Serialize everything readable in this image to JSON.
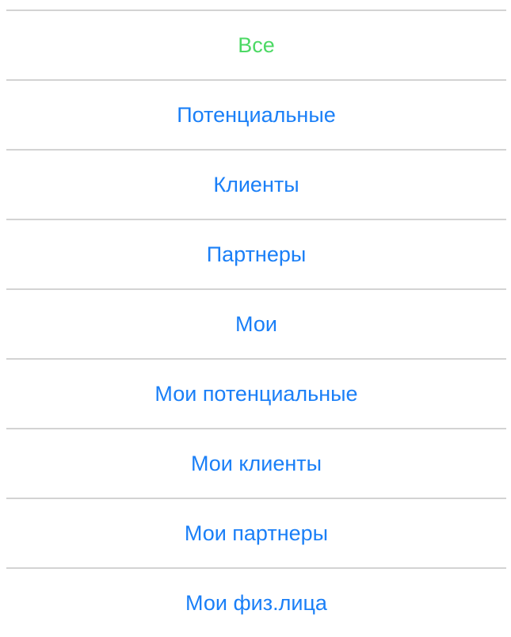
{
  "filter_menu": {
    "selected_color": "#4cd964",
    "item_color": "#1a7ff7",
    "divider_color": "#d3d3d3",
    "items": [
      {
        "label": "Все",
        "selected": true
      },
      {
        "label": "Потенциальные",
        "selected": false
      },
      {
        "label": "Клиенты",
        "selected": false
      },
      {
        "label": "Партнеры",
        "selected": false
      },
      {
        "label": "Мои",
        "selected": false
      },
      {
        "label": "Мои потенциальные",
        "selected": false
      },
      {
        "label": "Мои клиенты",
        "selected": false
      },
      {
        "label": "Мои партнеры",
        "selected": false
      },
      {
        "label": "Мои физ.лица",
        "selected": false
      }
    ]
  }
}
